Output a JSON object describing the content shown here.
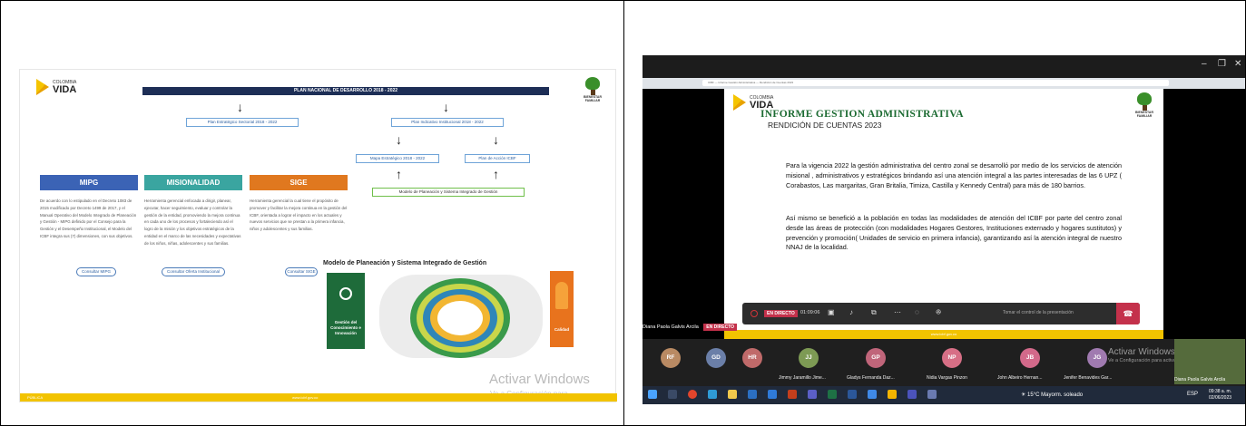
{
  "left": {
    "logo": {
      "small": "COLOMBIA",
      "small2": "POTENCIA DE LA",
      "big": "VIDA"
    },
    "icbf_label": "BIENESTAR FAMILIAR",
    "pnd": "PLAN NACIONAL DE DESARROLLO 2018 - 2022",
    "boxes": {
      "sectorial": "Plan Estratégico Sectorial 2018 - 2022",
      "indicativo": "Plan Indicativo Institucional 2018 - 2022",
      "mapa": "Mapa Estratégico 2018 - 2022",
      "accion": "Plan de Acción ICBF",
      "modelo": "Modelo de Planeación y Sistema Integrado de Gestión"
    },
    "columns": [
      {
        "title": "MIPG",
        "color": "#3b63b5",
        "text": "De acuerdo con lo estipulado en el Decreto 1083 de 2015 modificado por Decreto 1499 de 2017, y el Manual Operativo del Modelo Integrado de Planeación y Gestión - MIPG definido por el Consejo para la Gestión y el Desempeño Institucional, el Modelo del ICBF integra sus (7) dimensiones, con sus objetivos.",
        "button": "Consultar MIPG"
      },
      {
        "title": "MISIONALIDAD",
        "color": "#3aa5a0",
        "text": "Herramienta gerencial enfocada a dirigir, planear, ejecutar, hacer seguimiento, evaluar y controlar la gestión de la entidad, promoviendo la mejora continua en cada uno de los procesos y fortaleciendo así el logro de la misión y los objetivos estratégicos de la entidad en el marco de las necesidades y expectativas de los niños, niñas, adolescentes y sus familias.",
        "button": "Consultar Oferta Institucional"
      },
      {
        "title": "SIGE",
        "color": "#e0781f",
        "text": "Herramienta gerencial la cual tiene el propósito de promover y facilitar la mejora continua en la gestión del ICBF, orientada a lograr el impacto en los actuales y nuevos servicios que se prestan a la primera infancia, niños y adolescentes y sus familias.",
        "button": "Consultar SIGE"
      }
    ],
    "model_title": "Modelo de Planeación y Sistema Integrado de Gestión",
    "green_panel": "Gestión del Conocimiento e Innovación",
    "orange_panel": "Calidad",
    "footer_left": "PÚBLICA",
    "footer_center": "www.icbf.gov.co",
    "watermark": "Activar Windows",
    "watermark_sub": "Ve a Configuración para"
  },
  "right": {
    "browser_tab": "ICBF — Informe Gestión Administrativa — Rendición de Cuentas 2023",
    "logo": {
      "small": "COLOMBIA",
      "small2": "POTENCIA DE LA",
      "big": "VIDA"
    },
    "icbf_label": "BIENESTAR FAMILIAR",
    "title": "INFORME GESTION ADMINISTRATIVA",
    "subtitle": "RENDICIÓN DE CUENTAS 2023",
    "para1": "Para la vigencia 2022 la gestión administrativa del centro zonal se desarrolló por medio de los servicios de atención misional , administrativos y estratégicos brindando así una atención integral a las partes interesadas de las 6 UPZ ( Corabastos, Las margaritas, Gran Britalia, Timiza, Castilla y Kennedy Central) para más de 180 barrios.",
    "para2": "Así mismo se benefició a la población en todas las modalidades de atención del ICBF por parte del centro zonal desde las áreas de protección (con modalidades Hogares Gestores, Instituciones externado y hogares sustitutos) y prevención y promoción( Unidades de servicio en primera infancia), garantizando así la atención integral de nuestro NNAJ de la localidad.",
    "footer": "www.icbf.gov.co",
    "live": "EN DIRECTO",
    "time": "01:09:06",
    "control": "Tomar el control de la presentación",
    "presenter": "Diana Paola Galvis Arcila",
    "presenter_badge": "EN DIRECTO",
    "participants": [
      {
        "initials": "RF",
        "color": "#b98a63",
        "name": ""
      },
      {
        "initials": "GD",
        "color": "#6b7fa8",
        "name": ""
      },
      {
        "initials": "HR",
        "color": "#c06a6a",
        "name": ""
      },
      {
        "initials": "JJ",
        "color": "#7d9a54",
        "name": "Jimmy Jaramillo Jime..."
      },
      {
        "initials": "GP",
        "color": "#c0657a",
        "name": "Gladys Fernanda Daz..."
      },
      {
        "initials": "NP",
        "color": "#d76f86",
        "name": "Nidia Vargas Pinzon"
      },
      {
        "initials": "JB",
        "color": "#d2698a",
        "name": "John Albeiro Hernan..."
      },
      {
        "initials": "JG",
        "color": "#a07ab0",
        "name": "Jenifer Benavides Gar..."
      }
    ],
    "video_name": "Diana Paola Galvis Arcila",
    "watermark": "Activar Windows",
    "watermark_sub": "Ve a Configuración para activar Windows",
    "weather": "15°C Mayorm. soleado",
    "lang": "ESP",
    "clock_time": "09:38 a. m.",
    "clock_date": "02/06/2023"
  }
}
